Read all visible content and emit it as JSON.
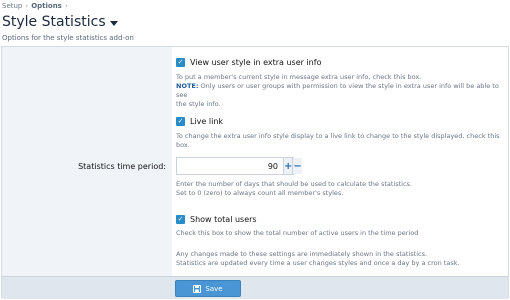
{
  "breadcrumb": {
    "items": [
      "Setup",
      "Options"
    ]
  },
  "header": {
    "title": "Style Statistics",
    "subtitle": "Options for the style statistics add-on"
  },
  "form": {
    "option1": {
      "label": "View user style in extra user info",
      "checked": true,
      "desc_line1": "To put a member's current style in message extra user info, check this box.",
      "note_label": "NOTE:",
      "note_text": "Only users or user groups with permission to view the style in extra user info will be able to see",
      "desc_line3": "the style info."
    },
    "option2": {
      "label": "Live link",
      "checked": true,
      "desc": "To change the extra user info style display to a live link to change to the style displayed, check this box."
    },
    "statistics_period": {
      "label": "Statistics time period:",
      "value": "90",
      "desc_line1": "Enter the number of days that should be used to calculate the statistics.",
      "desc_line2": "Set to 0 (zero) to always count all member's styles."
    },
    "option3": {
      "label": "Show total users",
      "checked": true,
      "desc": "Check this box to show the total number of active users in the time period"
    },
    "info_line1": "Any changes made to these settings are immediately shown in the statistics.",
    "info_line2": "Statistics are updated every time a user changes styles and once a day by a cron task."
  },
  "footer": {
    "save_label": "Save"
  },
  "colors": {
    "accent": "#2a8bc9",
    "button": "#4a95d3"
  }
}
